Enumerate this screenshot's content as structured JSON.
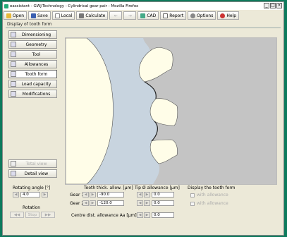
{
  "window": {
    "title": "eassistant - GWJ-Technology - Cylindrical gear pair - Mozilla Firefox"
  },
  "toolbar": {
    "open": "Open",
    "save": "Save",
    "local": "Local",
    "calculate": "Calculate",
    "undo": "←",
    "redo": "→",
    "cad": "CAD",
    "report": "Report",
    "options": "Options",
    "help": "Help"
  },
  "subtitle": "Display of tooth form",
  "sidebar": {
    "items": [
      {
        "label": "Dimensioning"
      },
      {
        "label": "Geometry"
      },
      {
        "label": "Tool"
      },
      {
        "label": "Allowances"
      },
      {
        "label": "Tooth form"
      },
      {
        "label": "Load capacity"
      },
      {
        "label": "Modifications"
      }
    ],
    "total_view": "Total view",
    "detail_view": "Detail view"
  },
  "rotation": {
    "angle_label": "Rotating angle [°]",
    "angle_value": "4.0",
    "rotation_label": "Rotation",
    "stop": "Stop"
  },
  "tooth_thickness": {
    "header": "Tooth thick. allow. [µm]",
    "gear1_label": "Gear 1",
    "gear2_label": "Gear 2",
    "gear1_value": "-90.0",
    "gear2_value": "-120.0"
  },
  "tip_allowance": {
    "header": "Tip Ø allowance [µm]",
    "gear1_value": "0.0",
    "gear2_value": "0.0"
  },
  "centre_dist": {
    "label": "Centre dist. allowance Aa [µm]",
    "value": "0.0"
  },
  "display": {
    "header": "Display the tooth form",
    "opt1": "with allowance",
    "opt2": "with allowance"
  }
}
